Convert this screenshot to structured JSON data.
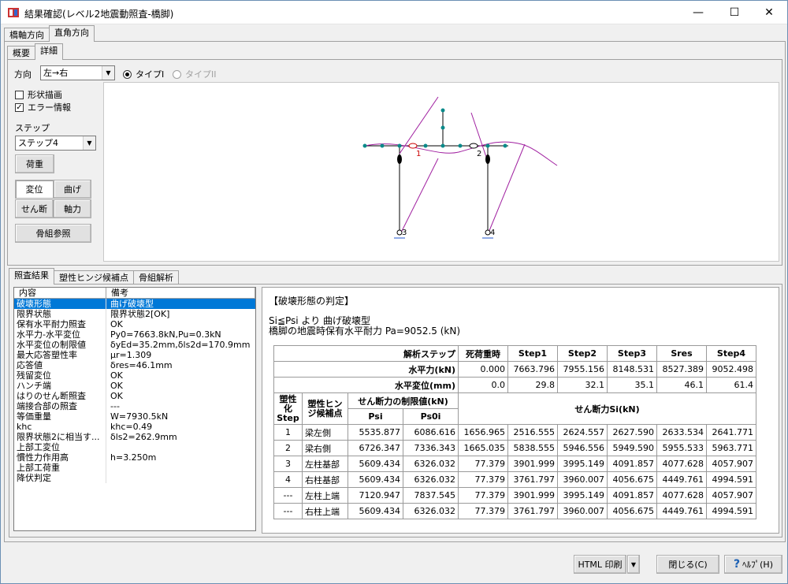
{
  "window": {
    "title": "結果確認(レベル2地震動照査-橋脚)",
    "min": "—",
    "max": "☐",
    "close": "✕"
  },
  "tabs_top": [
    "橋軸方向",
    "直角方向"
  ],
  "tabs_sub": [
    "概要",
    "詳細"
  ],
  "direction": {
    "label": "方向",
    "value": "左→右",
    "radio1": "タイプI",
    "radio2": "タイプII"
  },
  "left_panel": {
    "chk_shape": "形状描画",
    "chk_error": "エラー情報",
    "step_label": "ステップ",
    "step_value": "ステップ4",
    "btn_load": "荷重",
    "btn_disp": "変位",
    "btn_bend": "曲げ",
    "btn_shear": "せん断",
    "btn_axial": "軸力",
    "btn_frame": "骨組参照"
  },
  "diagram": {
    "labels": [
      "1",
      "2",
      "3",
      "4"
    ]
  },
  "tabs_bottom": [
    "照査結果",
    "塑性ヒンジ候補点",
    "骨組解析"
  ],
  "list": {
    "header": [
      "内容",
      "備考"
    ],
    "rows": [
      [
        "破壊形態",
        "曲げ破壊型"
      ],
      [
        "限界状態",
        "限界状態2[OK]"
      ],
      [
        "保有水平耐力照査",
        "OK"
      ],
      [
        "水平力-水平変位",
        "Py0=7663.8kN,Pu=0.3kN"
      ],
      [
        "水平変位の制限値",
        "δyEd=35.2mm,δls2d=170.9mm"
      ],
      [
        "最大応答塑性率",
        "μr=1.309"
      ],
      [
        "応答値",
        "δres=46.1mm"
      ],
      [
        "残留変位",
        "OK"
      ],
      [
        "ハンチ端",
        "OK"
      ],
      [
        "はりのせん断照査",
        "OK"
      ],
      [
        "端接合部の照査",
        "---"
      ],
      [
        "等価重量",
        "W=7930.5kN"
      ],
      [
        "khc",
        "khc=0.49"
      ],
      [
        "限界状態2に相当す...",
        "δls2=262.9mm"
      ],
      [
        "上部工変位",
        ""
      ],
      [
        "慣性力作用高",
        "h=3.250m"
      ],
      [
        "上部工荷重",
        ""
      ],
      [
        "降伏判定",
        ""
      ]
    ]
  },
  "detail": {
    "heading": "【破壊形態の判定】",
    "line1": "Si≦Psi より 曲げ破壊型",
    "line2": "橋脚の地震時保有水平耐力  Pa=9052.5 (kN)",
    "table": {
      "step_header": "解析ステップ",
      "steps": [
        "死荷重時",
        "Step1",
        "Step2",
        "Step3",
        "Sres",
        "Step4"
      ],
      "h_force": "水平力(kN)",
      "force": [
        "0.000",
        "7663.796",
        "7955.156",
        "8148.531",
        "8527.389",
        "9052.498"
      ],
      "h_disp": "水平変位(mm)",
      "disp": [
        "0.0",
        "29.8",
        "32.1",
        "35.1",
        "46.1",
        "61.4"
      ],
      "col_a": "塑性化Step",
      "col_b": "塑性ヒンジ候補点",
      "col_limit": "せん断力の制限値(kN)",
      "psi": "Psi",
      "ps0i": "Ps0i",
      "si": "せん断力Si(kN)",
      "rows": [
        [
          "1",
          "梁左側",
          "5535.877",
          "6086.616",
          "1656.965",
          "2516.555",
          "2624.557",
          "2627.590",
          "2633.534",
          "2641.771"
        ],
        [
          "2",
          "梁右側",
          "6726.347",
          "7336.343",
          "1665.035",
          "5838.555",
          "5946.556",
          "5949.590",
          "5955.533",
          "5963.771"
        ],
        [
          "3",
          "左柱基部",
          "5609.434",
          "6326.032",
          "77.379",
          "3901.999",
          "3995.149",
          "4091.857",
          "4077.628",
          "4057.907"
        ],
        [
          "4",
          "右柱基部",
          "5609.434",
          "6326.032",
          "77.379",
          "3761.797",
          "3960.007",
          "4056.675",
          "4449.761",
          "4994.591"
        ],
        [
          "---",
          "左柱上端",
          "7120.947",
          "7837.545",
          "77.379",
          "3901.999",
          "3995.149",
          "4091.857",
          "4077.628",
          "4057.907"
        ],
        [
          "---",
          "右柱上端",
          "5609.434",
          "6326.032",
          "77.379",
          "3761.797",
          "3960.007",
          "4056.675",
          "4449.761",
          "4994.591"
        ]
      ]
    }
  },
  "footer": {
    "html_print": "HTML 印刷",
    "close": "閉じる(C)",
    "help": "ﾍﾙﾌﾟ(H)"
  }
}
